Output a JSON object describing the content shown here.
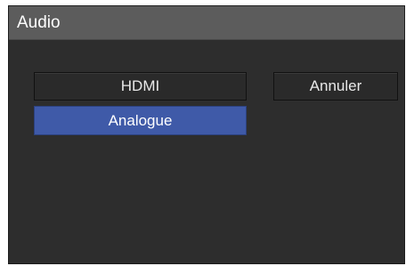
{
  "dialog": {
    "title": "Audio"
  },
  "options": [
    {
      "label": "HDMI",
      "selected": false
    },
    {
      "label": "Analogue",
      "selected": true
    }
  ],
  "cancel_label": "Annuler",
  "colors": {
    "background": "#2d2d2d",
    "titlebar": "#5c5c5c",
    "selected": "#3f5aa8",
    "text": "#ffffff"
  }
}
